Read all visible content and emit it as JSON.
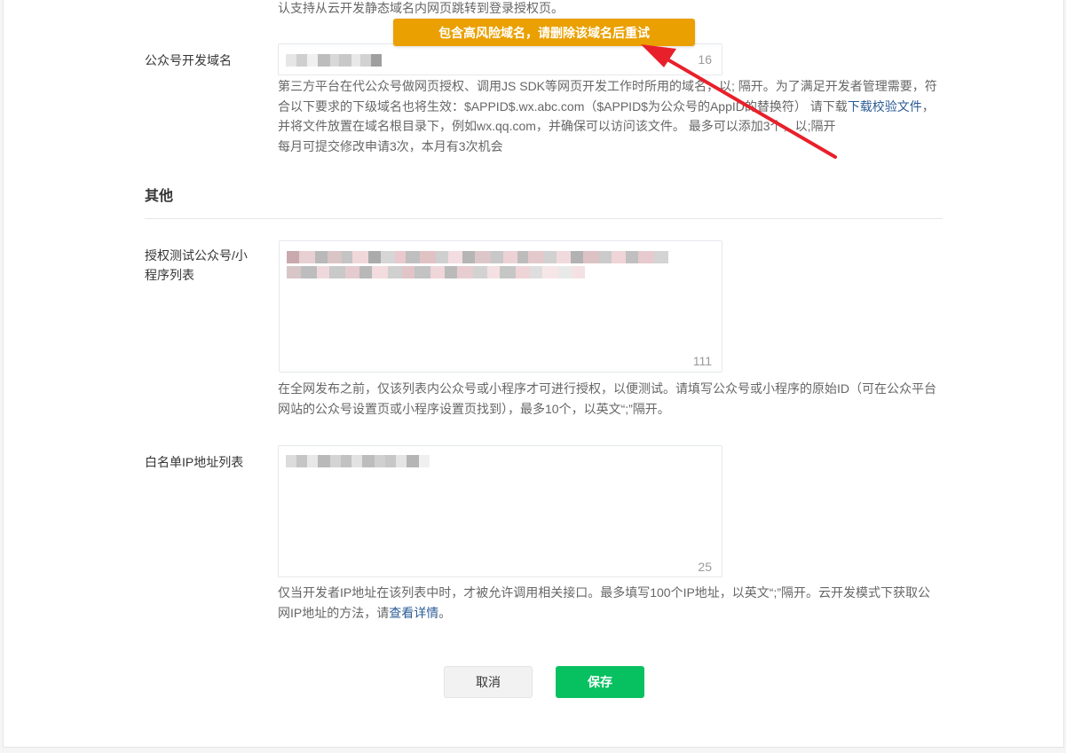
{
  "top_partial_text": "认支持从云开发静态域名内网页跳转到登录授权页。",
  "toast": {
    "message": "包含高风险域名，请删除该域名后重试"
  },
  "dev_domain": {
    "label": "公众号开发域名",
    "count": "16",
    "desc_line1": "第三方平台在代公众号做网页授权、调用JS SDK等网页开发工作时所用的域名，以; 隔开。为了满足开发者管理需要，符",
    "desc_line2_pre": "合以下要求的下级域名也将生效：$APPID$.wx.abc.com（$APPID$为公众号的AppID的替换符） 请下载",
    "desc_line2_link": "下载校验文件",
    "desc_line2_post": "，",
    "desc_line3": "并将文件放置在域名根目录下，例如wx.qq.com，并确保可以访问该文件。 最多可以添加3个，以;隔开",
    "desc_line4": "每月可提交修改申请3次，本月有3次机会"
  },
  "other_section": {
    "title": "其他"
  },
  "test_list": {
    "label_line1": "授权测试公众号/小",
    "label_line2": "程序列表",
    "count": "111",
    "desc_line1": "在全网发布之前，仅该列表内公众号或小程序才可进行授权，以便测试。请填写公众号或小程序的原始ID（可在公众平台",
    "desc_line2": "网站的公众号设置页或小程序设置页找到），最多10个，以英文“;”隔开。"
  },
  "ip_whitelist": {
    "label": "白名单IP地址列表",
    "count": "25",
    "desc_line1": "仅当开发者IP地址在该列表中时，才被允许调用相关接口。最多填写100个IP地址，以英文“;”隔开。云开发模式下获取公",
    "desc_line2_pre": "网IP地址的方法，请",
    "desc_line2_link": "查看详情",
    "desc_line2_post": "。"
  },
  "actions": {
    "cancel_label": "取消",
    "save_label": "保存"
  },
  "colors": {
    "accent_green": "#07c160",
    "toast_orange": "#eaa000",
    "arrow_red": "#e8202b",
    "link_blue": "#2b5c96"
  }
}
